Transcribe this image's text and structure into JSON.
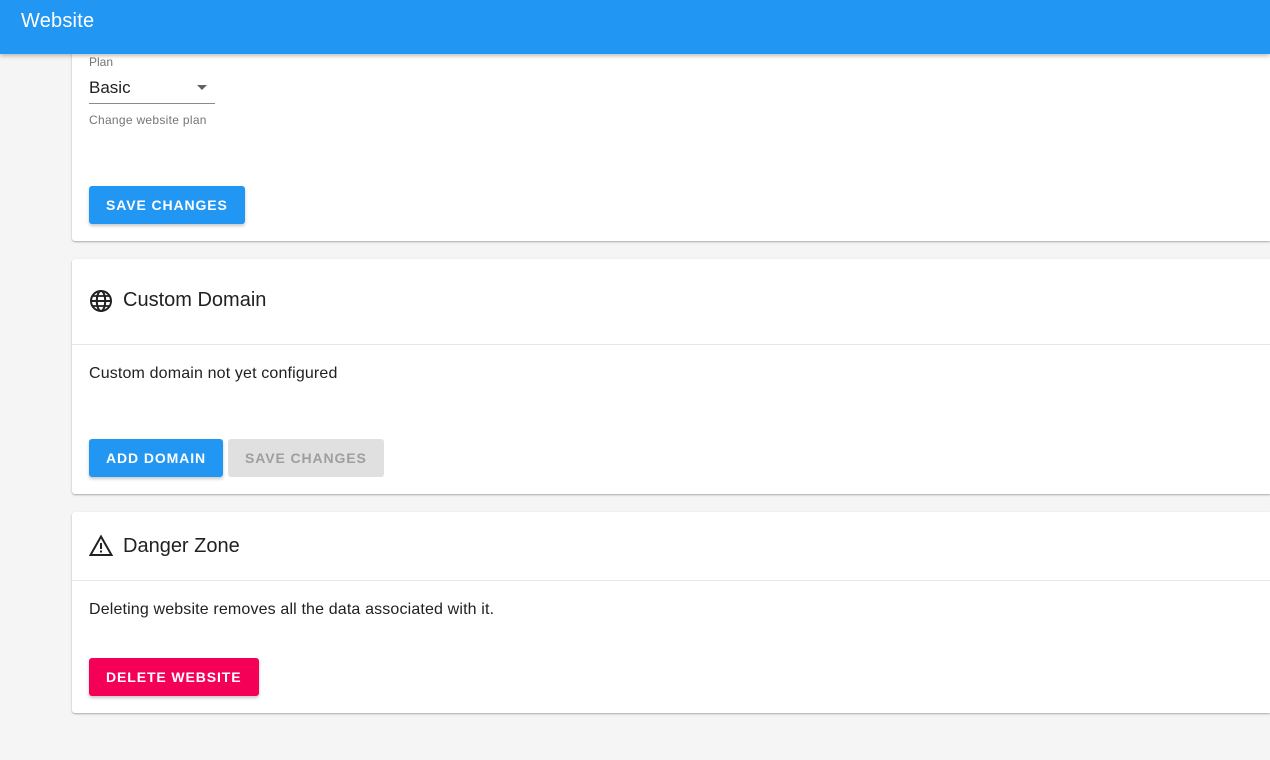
{
  "app_bar": {
    "title": "Website"
  },
  "plan_card": {
    "field_label": "Plan",
    "selected_plan": "Basic",
    "hint": "Change website plan",
    "save_label": "SAVE CHANGES"
  },
  "domain_card": {
    "icon": "globe-icon",
    "title": "Custom Domain",
    "status_text": "Custom domain not yet configured",
    "add_label": "ADD DOMAIN",
    "save_label": "SAVE CHANGES"
  },
  "danger_card": {
    "icon": "warning-icon",
    "title": "Danger Zone",
    "description": "Deleting website removes all the data associated with it.",
    "delete_label": "DELETE WEBSITE"
  },
  "colors": {
    "primary": "#2196f3",
    "danger": "#f50057",
    "disabled": "#e0e0e0"
  }
}
